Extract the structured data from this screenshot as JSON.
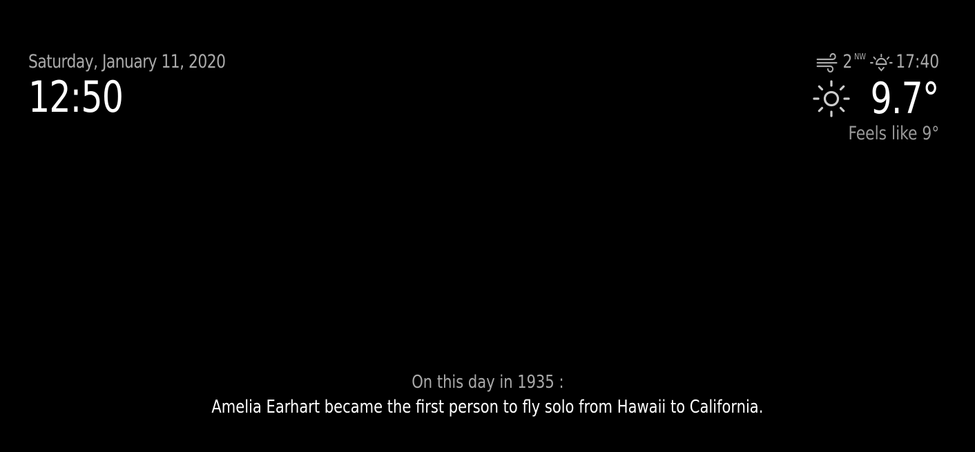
{
  "clock": {
    "date": "Saturday, January 11, 2020",
    "time": "12:50"
  },
  "weather": {
    "wind_speed": "2",
    "wind_direction": "NW",
    "sunset_time": "17:40",
    "temperature": "9.7°",
    "feels_like": "Feels like 9°",
    "icons": {
      "wind": "wind-icon",
      "sunset": "sunset-icon",
      "condition": "sun-icon"
    }
  },
  "history": {
    "heading": "On this day in 1935 :",
    "event": "Amelia Earhart became the first person to fly solo from Hawaii to California."
  },
  "colors": {
    "background": "#000000",
    "bright_text": "#ffffff",
    "dim_text": "#aaaaaa"
  }
}
